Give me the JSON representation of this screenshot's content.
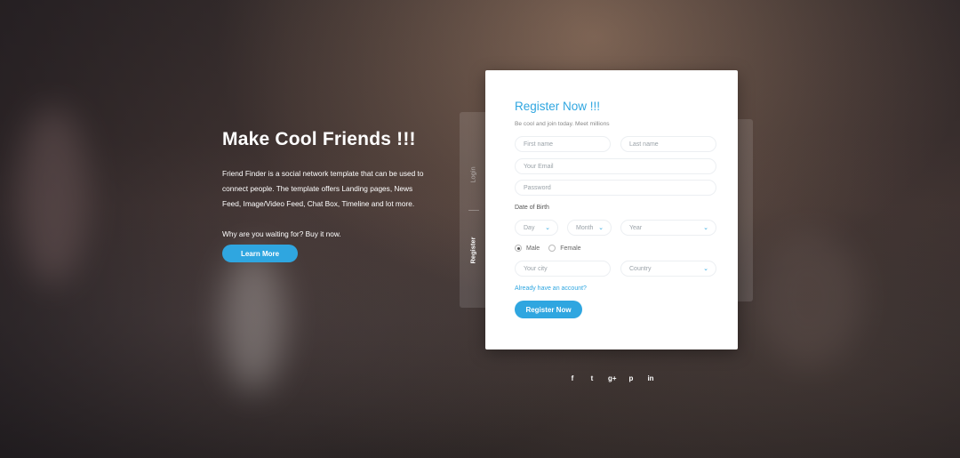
{
  "hero": {
    "title": "Make Cool Friends !!!",
    "description": "Friend Finder is a social network template that can be used to connect people. The template offers Landing pages, News Feed, Image/Video Feed, Chat Box, Timeline and lot more.",
    "ask": "Why are you waiting for? Buy it now.",
    "button_label": "Learn More"
  },
  "tabs": {
    "login": "Login",
    "register": "Register"
  },
  "form": {
    "title": "Register Now !!!",
    "subtitle": "Be cool and join today. Meet millions",
    "first_name_placeholder": "First name",
    "last_name_placeholder": "Last name",
    "email_placeholder": "Your Email",
    "password_placeholder": "Password",
    "dob_label": "Date of Birth",
    "day": "Day",
    "month": "Month",
    "year": "Year",
    "gender_male": "Male",
    "gender_female": "Female",
    "city_placeholder": "Your city",
    "country": "Country",
    "login_link": "Already have an account?",
    "submit_label": "Register Now"
  },
  "social": [
    "f",
    "t",
    "g+",
    "p",
    "in"
  ],
  "colors": {
    "accent": "#2fa6e0"
  }
}
